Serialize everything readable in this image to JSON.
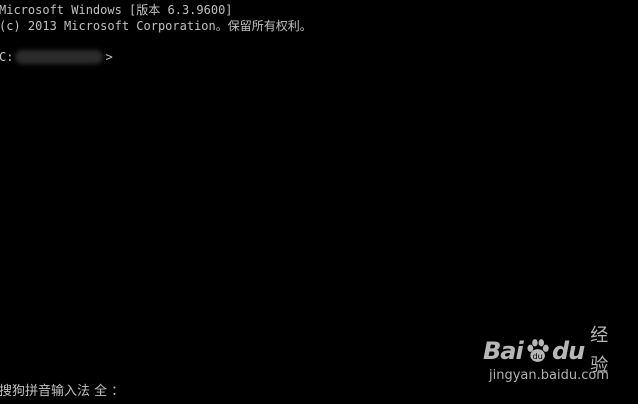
{
  "console": {
    "line1": "Microsoft Windows [版本 6.3.9600]",
    "line2": "(c) 2013 Microsoft Corporation。保留所有权利。",
    "prompt_prefix": "C:",
    "prompt_suffix": ">"
  },
  "ime": {
    "status": "搜狗拼音输入法 全 ："
  },
  "watermark": {
    "brand_left": "Bai",
    "brand_right": "du",
    "brand_cn": "经验",
    "url": "jingyan.baidu.com"
  },
  "colors": {
    "background": "#000000",
    "text": "#c0c0c0"
  }
}
